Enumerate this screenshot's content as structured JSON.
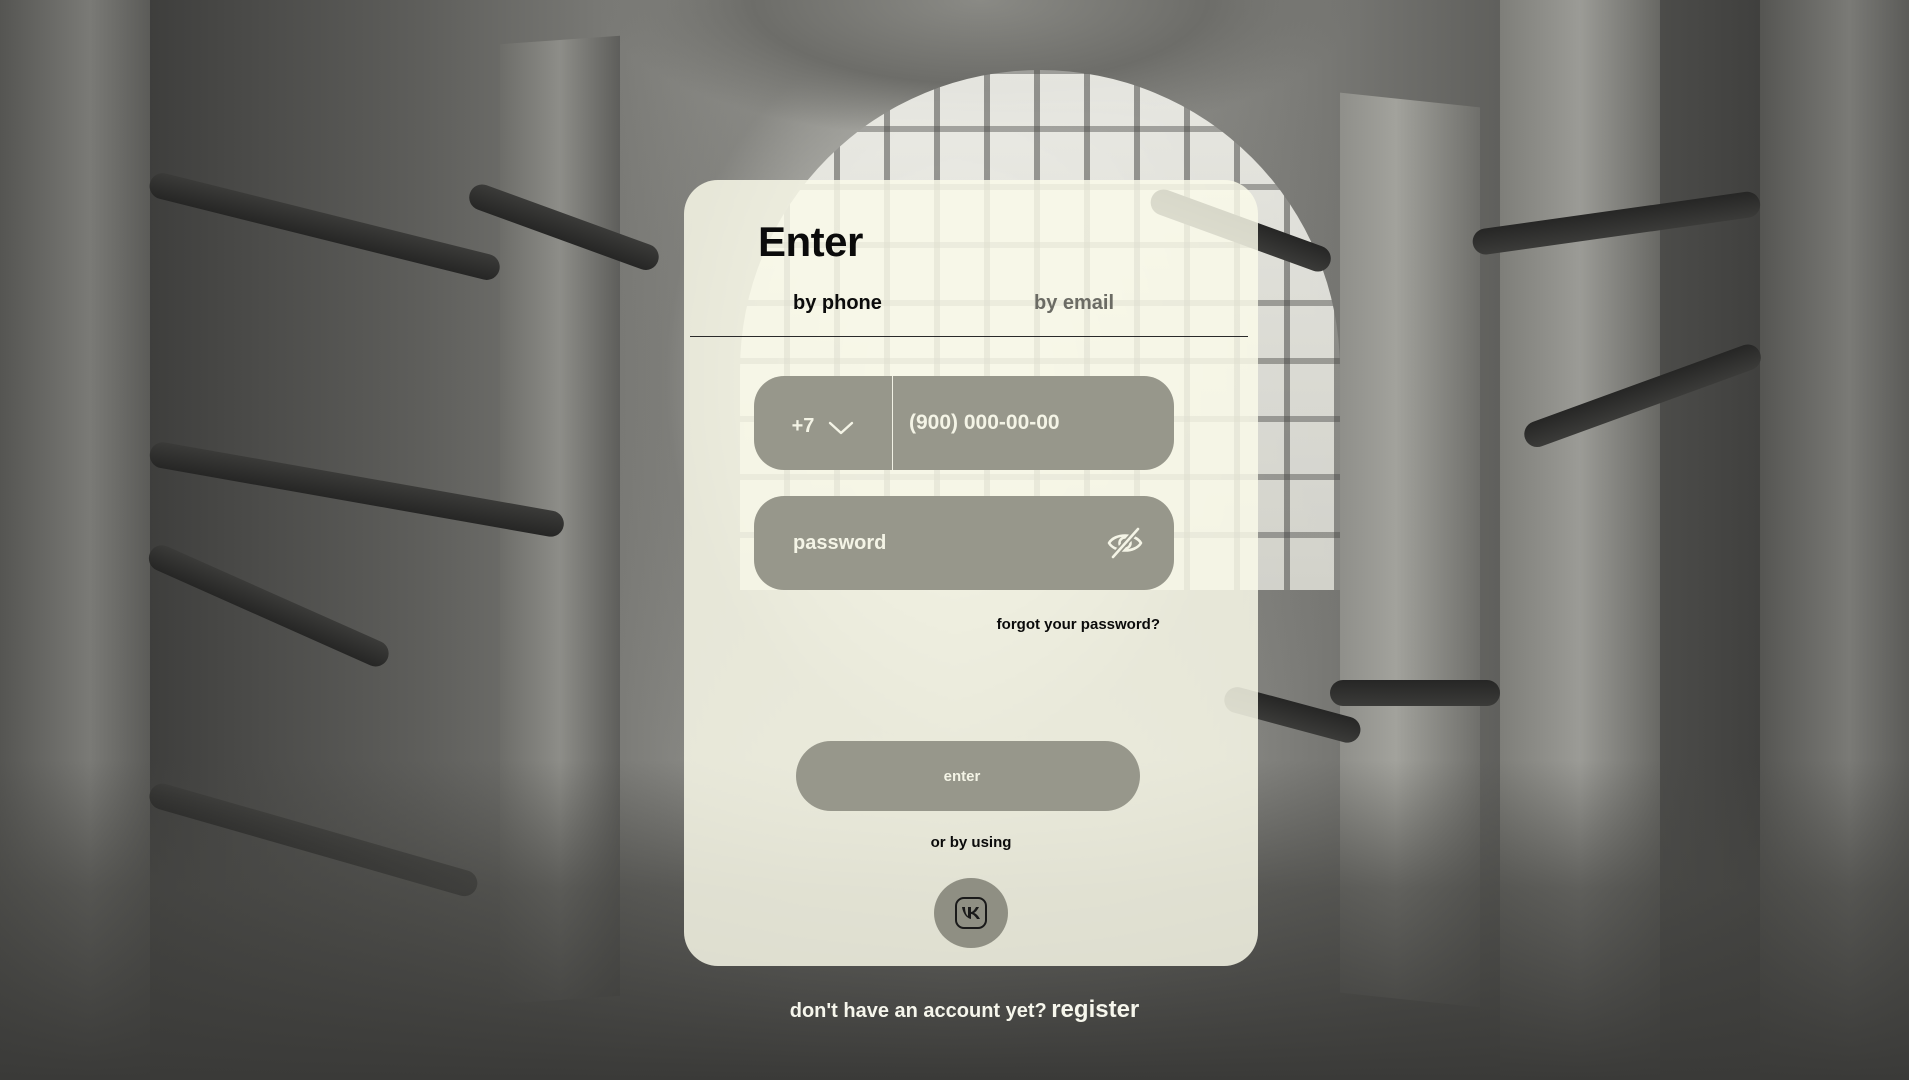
{
  "login": {
    "title": "Enter",
    "tabs": [
      {
        "label": "by phone",
        "active": true
      },
      {
        "label": "by email",
        "active": false
      }
    ],
    "phone": {
      "country_code": "+7",
      "placeholder": "(900) 000-00-00"
    },
    "password": {
      "placeholder": "password"
    },
    "forgot_label": "forgot your password?",
    "enter_label": "enter",
    "alt_login_label": "or by using",
    "alt_login_icons": [
      "vk-icon"
    ],
    "no_account_text": "don't have an account yet?",
    "register_label": "register"
  },
  "icons": {
    "country_code_toggle": "chevron-down-icon",
    "password_visibility": "eye-slash-icon",
    "social": "vk-icon"
  },
  "colors": {
    "card_background": "#fafaea",
    "field_fill": "#97978b",
    "field_text": "#f4f4e6",
    "active_tab": "#0b0b0b",
    "inactive_tab": "#6b6b64"
  }
}
